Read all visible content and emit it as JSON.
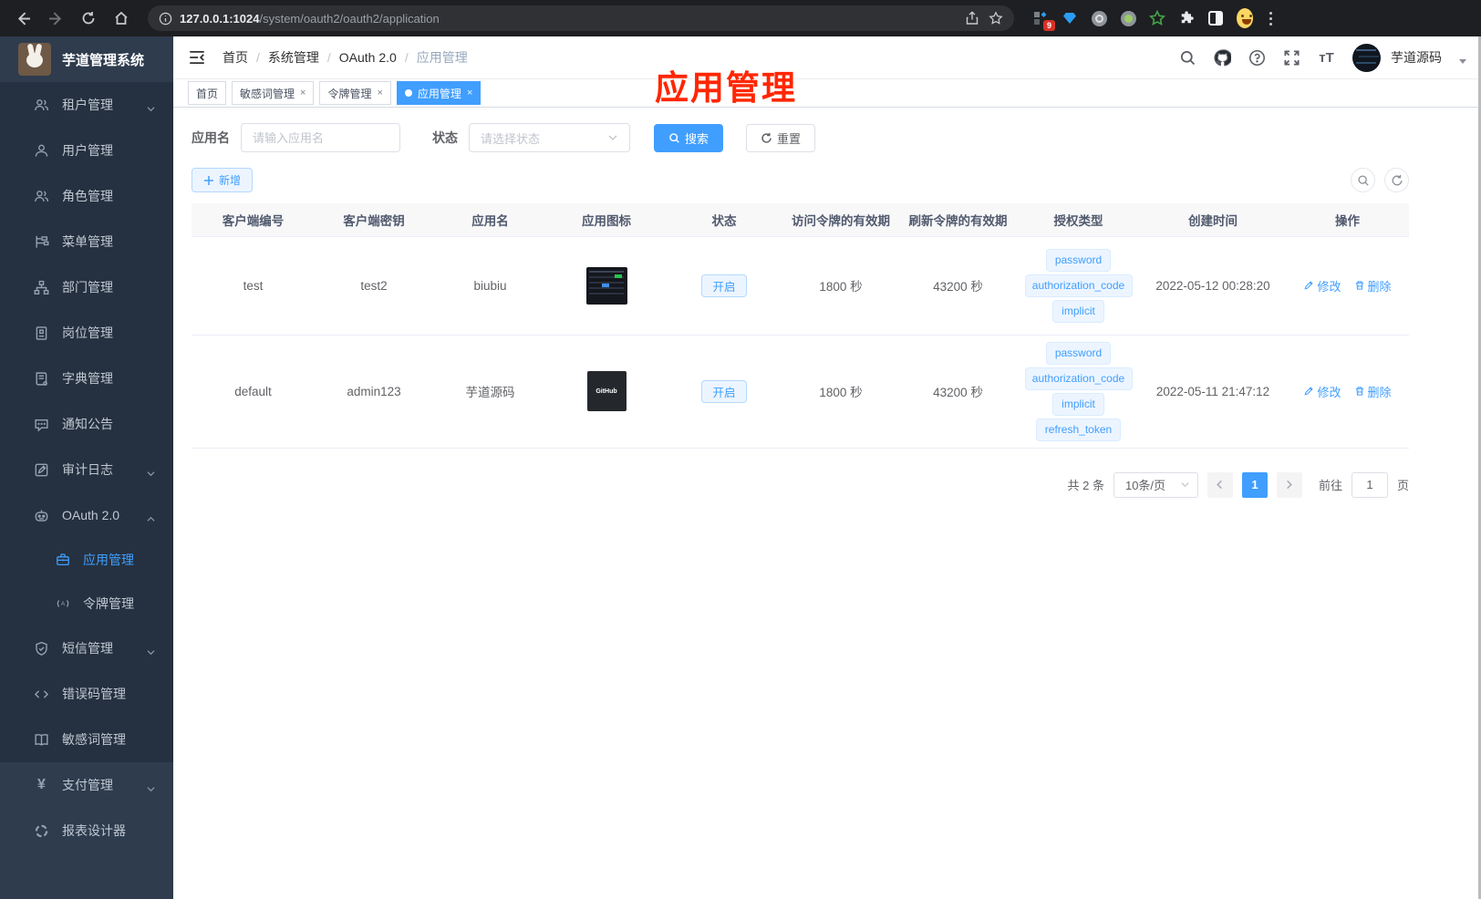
{
  "browser": {
    "url_host": "127.0.0.1:1024",
    "url_path": "/system/oauth2/oauth2/application",
    "ext_badge": "9"
  },
  "sidebar": {
    "title": "芋道管理系统",
    "menu": [
      "租户管理",
      "用户管理",
      "角色管理",
      "菜单管理",
      "部门管理",
      "岗位管理",
      "字典管理",
      "通知公告",
      "审计日志",
      "OAuth 2.0",
      "应用管理",
      "令牌管理",
      "短信管理",
      "错误码管理",
      "敏感词管理",
      "支付管理",
      "报表设计器"
    ]
  },
  "header": {
    "breadcrumb": [
      "首页",
      "系统管理",
      "OAuth 2.0",
      "应用管理"
    ],
    "username": "芋道源码"
  },
  "tabs": [
    {
      "label": "首页"
    },
    {
      "label": "敏感词管理"
    },
    {
      "label": "令牌管理"
    },
    {
      "label": "应用管理"
    }
  ],
  "annotation": {
    "text": "应用管理",
    "color": "#ff2600"
  },
  "filters": {
    "name_label": "应用名",
    "name_placeholder": "请输入应用名",
    "status_label": "状态",
    "status_placeholder": "请选择状态",
    "search_label": "搜索",
    "reset_label": "重置"
  },
  "toolbar": {
    "add_label": "新增"
  },
  "table": {
    "headers": [
      "客户端编号",
      "客户端密钥",
      "应用名",
      "应用图标",
      "状态",
      "访问令牌的有效期",
      "刷新令牌的有效期",
      "授权类型",
      "创建时间",
      "操作"
    ],
    "rows": [
      {
        "client_id": "test",
        "secret": "test2",
        "name": "biubiu",
        "status": "开启",
        "access_ttl": "1800 秒",
        "refresh_ttl": "43200 秒",
        "grants": [
          "password",
          "authorization_code",
          "implicit"
        ],
        "created": "2022-05-12 00:28:20",
        "edit": "修改",
        "remove": "删除"
      },
      {
        "client_id": "default",
        "secret": "admin123",
        "name": "芋道源码",
        "icon_label": "GitHub",
        "status": "开启",
        "access_ttl": "1800 秒",
        "refresh_ttl": "43200 秒",
        "grants": [
          "password",
          "authorization_code",
          "implicit",
          "refresh_token"
        ],
        "created": "2022-05-11 21:47:12",
        "edit": "修改",
        "remove": "删除"
      }
    ]
  },
  "pagination": {
    "total": "共 2 条",
    "page_size": "10条/页",
    "current_page": "1",
    "goto_label": "前往",
    "goto_value": "1",
    "page_label": "页"
  },
  "colors": {
    "accent": "#409eff",
    "annotation_red": "#ff2600"
  }
}
